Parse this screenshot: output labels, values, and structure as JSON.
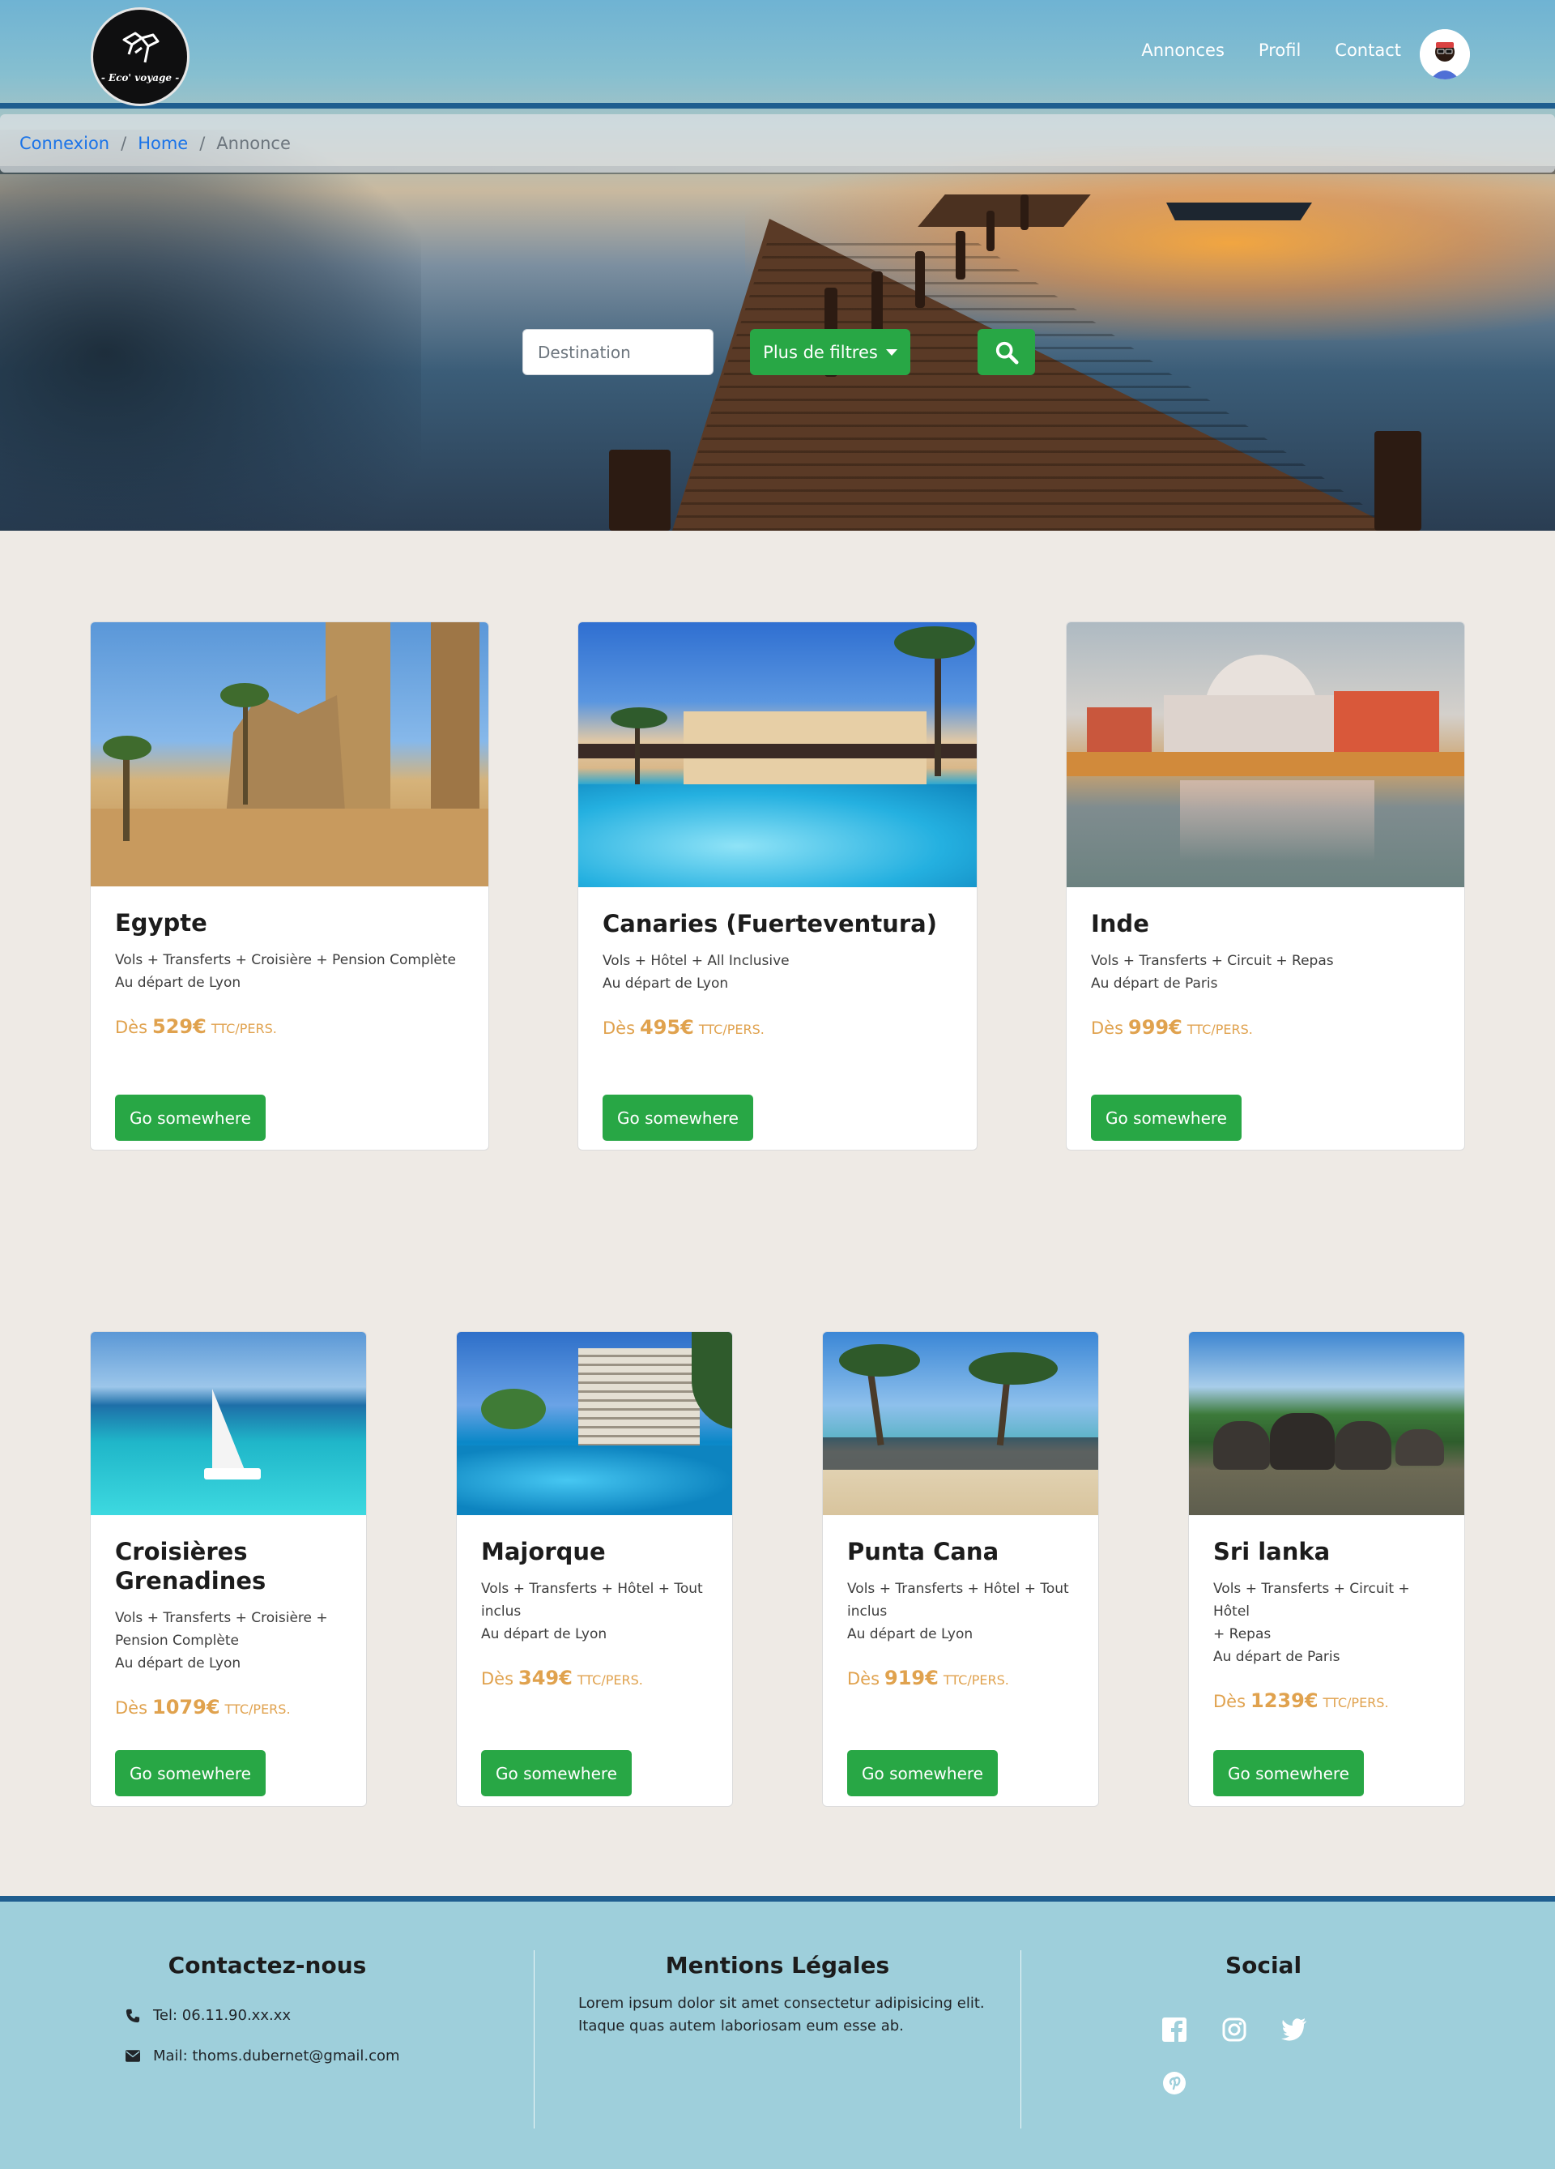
{
  "brand": {
    "logo_text": "- Eco' voyage -"
  },
  "nav": {
    "links": [
      {
        "label": "Annonces"
      },
      {
        "label": "Profil"
      },
      {
        "label": "Contact"
      }
    ]
  },
  "breadcrumb": {
    "items": [
      {
        "label": "Connexion"
      },
      {
        "label": "Home"
      },
      {
        "label": "Annonce"
      }
    ],
    "separator": "/"
  },
  "search": {
    "destination_placeholder": "Destination",
    "destination_value": "",
    "filters_label": "Plus de filtres"
  },
  "offers": [
    {
      "title": "Egypte",
      "lines": [
        "Vols + Transferts + Croisière + Pension Complète",
        "Au départ de Lyon"
      ],
      "price_prefix": "Dès",
      "price": "529€",
      "price_unit": "TTC/PERS.",
      "button": "Go somewhere"
    },
    {
      "title": "Canaries (Fuerteventura)",
      "lines": [
        "Vols + Hôtel + All Inclusive",
        "Au départ de Lyon"
      ],
      "price_prefix": "Dès",
      "price": "495€",
      "price_unit": "TTC/PERS.",
      "button": "Go somewhere"
    },
    {
      "title": "Inde",
      "lines": [
        "Vols + Transferts + Circuit + Repas",
        "Au départ de Paris"
      ],
      "price_prefix": "Dès",
      "price": "999€",
      "price_unit": "TTC/PERS.",
      "button": "Go somewhere"
    },
    {
      "title": "Croisières Grenadines",
      "lines": [
        "Vols + Transferts + Croisière +",
        "Pension Complète",
        "Au départ de Lyon"
      ],
      "price_prefix": "Dès",
      "price": "1079€",
      "price_unit": "TTC/PERS.",
      "button": "Go somewhere"
    },
    {
      "title": "Majorque",
      "lines": [
        "Vols + Transferts + Hôtel + Tout",
        "inclus",
        "Au départ de Lyon"
      ],
      "price_prefix": "Dès",
      "price": "349€",
      "price_unit": "TTC/PERS.",
      "button": "Go somewhere"
    },
    {
      "title": "Punta Cana",
      "lines": [
        "Vols + Transferts + Hôtel + Tout",
        "inclus",
        "Au départ de Lyon"
      ],
      "price_prefix": "Dès",
      "price": "919€",
      "price_unit": "TTC/PERS.",
      "button": "Go somewhere"
    },
    {
      "title": "Sri lanka",
      "lines": [
        "Vols + Transferts + Circuit + Hôtel",
        "+ Repas",
        "Au départ de Paris"
      ],
      "price_prefix": "Dès",
      "price": "1239€",
      "price_unit": "TTC/PERS.",
      "button": "Go somewhere"
    }
  ],
  "footer": {
    "contact": {
      "title": "Contactez-nous",
      "phone": "Tel: 06.11.90.xx.xx",
      "mail": "Mail: thoms.dubernet@gmail.com"
    },
    "legal": {
      "title": "Mentions Légales",
      "text": "Lorem ipsum dolor sit amet consectetur adipisicing elit. Itaque quas autem laboriosam eum esse ab."
    },
    "social": {
      "title": "Social",
      "icons": [
        "facebook-icon",
        "instagram-icon",
        "twitter-icon",
        "pinterest-icon"
      ]
    }
  },
  "colors": {
    "accent_green": "#28a745",
    "nav_bar_blue": "#1f5e8f",
    "price_orange": "#e0a24e",
    "footer_bg": "#9ecfdb",
    "page_bg": "#eeeae5"
  }
}
